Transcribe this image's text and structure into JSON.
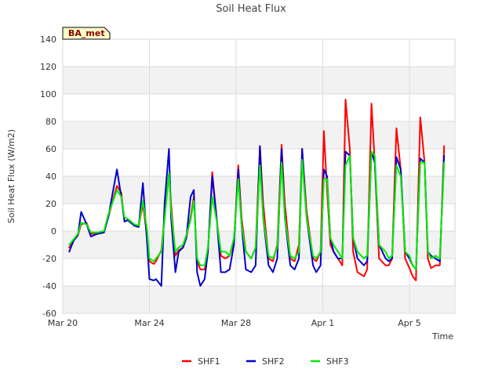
{
  "chart_data": {
    "type": "line",
    "title": "Soil Heat Flux",
    "xlabel": "Time",
    "ylabel": "Soil Heat Flux (W/m2)",
    "badge": "BA_met",
    "ylim": [
      -60,
      140
    ],
    "yticks": [
      -60,
      -40,
      -20,
      0,
      20,
      40,
      60,
      80,
      100,
      120,
      140
    ],
    "xticks": [
      {
        "day": 0,
        "label": "Mar 20"
      },
      {
        "day": 4,
        "label": "Mar 24"
      },
      {
        "day": 8,
        "label": "Mar 28"
      },
      {
        "day": 12,
        "label": "Apr 1"
      },
      {
        "day": 16,
        "label": "Apr 5"
      }
    ],
    "xlim_days": [
      0,
      18.1
    ],
    "grid": true,
    "legend": "bottom",
    "series": [
      {
        "name": "SHF1",
        "color": "#ff0000",
        "x": [
          0.3,
          0.5,
          0.7,
          0.85,
          1.1,
          1.3,
          1.6,
          1.9,
          2.1,
          2.5,
          2.7,
          2.85,
          3.0,
          3.3,
          3.5,
          3.7,
          3.9,
          4.0,
          4.2,
          4.3,
          4.55,
          4.7,
          4.9,
          5.0,
          5.2,
          5.35,
          5.55,
          5.7,
          5.9,
          6.05,
          6.2,
          6.35,
          6.55,
          6.7,
          6.9,
          7.1,
          7.3,
          7.5,
          7.7,
          7.9,
          8.1,
          8.25,
          8.45,
          8.7,
          8.9,
          9.1,
          9.25,
          9.5,
          9.7,
          9.9,
          10.1,
          10.25,
          10.5,
          10.7,
          10.9,
          11.05,
          11.25,
          11.55,
          11.7,
          11.9,
          12.05,
          12.2,
          12.35,
          12.5,
          12.7,
          12.9,
          13.05,
          13.25,
          13.4,
          13.6,
          13.9,
          14.05,
          14.25,
          14.4,
          14.6,
          14.9,
          15.05,
          15.2,
          15.4,
          15.6,
          15.8,
          16.0,
          16.15,
          16.3,
          16.5,
          16.7,
          16.85,
          17.0,
          17.2,
          17.4,
          17.6
        ],
        "y": [
          -12,
          -7,
          -3,
          5,
          6,
          -2,
          -2,
          -1,
          10,
          33,
          28,
          7,
          8,
          4,
          3,
          20,
          -5,
          -22,
          -24,
          -22,
          -14,
          10,
          42,
          20,
          -18,
          -14,
          -12,
          -5,
          10,
          25,
          -22,
          -28,
          -28,
          -15,
          43,
          10,
          -18,
          -20,
          -18,
          -8,
          48,
          10,
          -15,
          -20,
          -12,
          62,
          20,
          -20,
          -22,
          -10,
          63,
          20,
          -20,
          -22,
          -10,
          60,
          15,
          -20,
          -22,
          -15,
          73,
          30,
          -10,
          -15,
          -20,
          -25,
          96,
          60,
          -15,
          -30,
          -33,
          -28,
          93,
          50,
          -20,
          -25,
          -25,
          -20,
          75,
          45,
          -20,
          -27,
          -33,
          -36,
          83,
          50,
          -20,
          -27,
          -25,
          -25,
          62
        ]
      },
      {
        "name": "SHF2",
        "color": "#0000cc",
        "x": [
          0.3,
          0.5,
          0.7,
          0.85,
          1.1,
          1.3,
          1.6,
          1.9,
          2.1,
          2.5,
          2.7,
          2.85,
          3.0,
          3.3,
          3.5,
          3.7,
          3.9,
          4.0,
          4.2,
          4.3,
          4.55,
          4.7,
          4.9,
          5.0,
          5.2,
          5.35,
          5.55,
          5.7,
          5.9,
          6.05,
          6.2,
          6.35,
          6.55,
          6.7,
          6.9,
          7.1,
          7.3,
          7.5,
          7.7,
          7.9,
          8.1,
          8.25,
          8.45,
          8.7,
          8.9,
          9.1,
          9.25,
          9.5,
          9.7,
          9.9,
          10.1,
          10.25,
          10.5,
          10.7,
          10.9,
          11.05,
          11.25,
          11.55,
          11.7,
          11.9,
          12.05,
          12.2,
          12.35,
          12.5,
          12.7,
          12.9,
          13.05,
          13.25,
          13.4,
          13.6,
          13.9,
          14.05,
          14.25,
          14.4,
          14.6,
          14.9,
          15.05,
          15.2,
          15.4,
          15.6,
          15.8,
          16.0,
          16.15,
          16.3,
          16.5,
          16.7,
          16.85,
          17.0,
          17.2,
          17.4,
          17.6
        ],
        "y": [
          -15,
          -7,
          -3,
          14,
          5,
          -4,
          -2,
          -1,
          10,
          45,
          25,
          7,
          8,
          4,
          3,
          35,
          -10,
          -35,
          -36,
          -35,
          -40,
          20,
          60,
          10,
          -30,
          -15,
          -12,
          -5,
          25,
          30,
          -30,
          -40,
          -35,
          -15,
          40,
          10,
          -30,
          -30,
          -28,
          -10,
          45,
          5,
          -28,
          -30,
          -25,
          62,
          10,
          -25,
          -30,
          -20,
          60,
          10,
          -25,
          -28,
          -20,
          60,
          10,
          -25,
          -30,
          -25,
          45,
          40,
          -5,
          -15,
          -20,
          -20,
          58,
          55,
          -5,
          -20,
          -25,
          -22,
          58,
          50,
          -10,
          -20,
          -22,
          -20,
          54,
          45,
          -15,
          -20,
          -25,
          -28,
          53,
          50,
          -15,
          -18,
          -20,
          -22,
          55
        ]
      },
      {
        "name": "SHF3",
        "color": "#00ee00",
        "x": [
          0.3,
          0.5,
          0.7,
          0.85,
          1.1,
          1.3,
          1.6,
          1.9,
          2.1,
          2.5,
          2.7,
          2.85,
          3.0,
          3.3,
          3.5,
          3.7,
          3.9,
          4.0,
          4.2,
          4.3,
          4.55,
          4.7,
          4.9,
          5.0,
          5.2,
          5.35,
          5.55,
          5.7,
          5.9,
          6.05,
          6.2,
          6.35,
          6.55,
          6.7,
          6.9,
          7.1,
          7.3,
          7.5,
          7.7,
          7.9,
          8.1,
          8.25,
          8.45,
          8.7,
          8.9,
          9.1,
          9.25,
          9.5,
          9.7,
          9.9,
          10.1,
          10.25,
          10.5,
          10.7,
          10.9,
          11.05,
          11.25,
          11.55,
          11.7,
          11.9,
          12.05,
          12.2,
          12.35,
          12.5,
          12.7,
          12.9,
          13.05,
          13.25,
          13.4,
          13.6,
          13.9,
          14.05,
          14.25,
          14.4,
          14.6,
          14.9,
          15.05,
          15.2,
          15.4,
          15.6,
          15.8,
          16.0,
          16.15,
          16.3,
          16.5,
          16.7,
          16.85,
          17.0,
          17.2,
          17.4,
          17.6
        ],
        "y": [
          -10,
          -6,
          -2,
          6,
          5,
          -1,
          -1,
          0,
          12,
          30,
          25,
          10,
          9,
          5,
          4,
          22,
          0,
          -20,
          -22,
          -20,
          -15,
          8,
          42,
          15,
          -15,
          -12,
          -10,
          -3,
          8,
          22,
          -20,
          -25,
          -25,
          -12,
          25,
          8,
          -15,
          -15,
          -18,
          -5,
          38,
          5,
          -15,
          -20,
          -12,
          48,
          10,
          -18,
          -20,
          -12,
          50,
          10,
          -18,
          -20,
          -15,
          52,
          10,
          -18,
          -20,
          -15,
          38,
          38,
          -5,
          -10,
          -15,
          -20,
          48,
          55,
          -5,
          -15,
          -20,
          -18,
          58,
          55,
          -10,
          -15,
          -20,
          -18,
          48,
          40,
          -15,
          -18,
          -25,
          -28,
          50,
          50,
          -15,
          -20,
          -18,
          -20,
          50
        ]
      }
    ]
  }
}
